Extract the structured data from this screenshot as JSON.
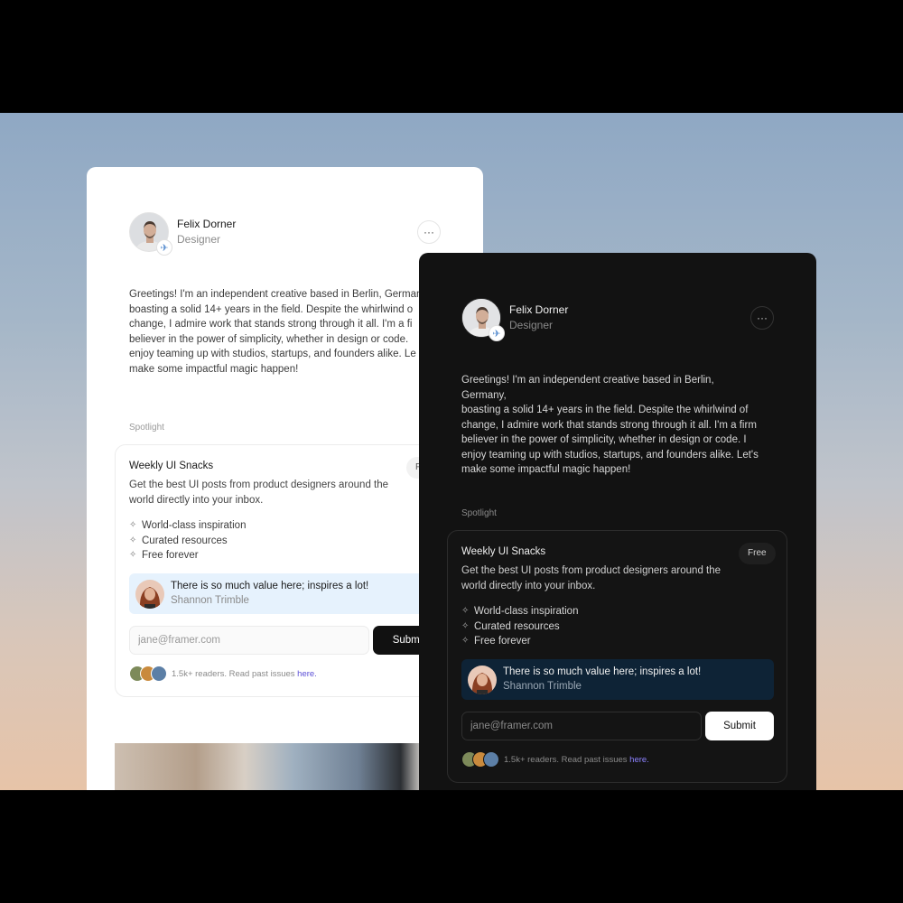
{
  "profile": {
    "name": "Felix Dorner",
    "role": "Designer",
    "more_label": "···",
    "badge_icon": "airplane-icon"
  },
  "bio_light": "Greetings! I'm an independent creative based in Berlin, German\nboasting a solid 14+ years in the field. Despite the whirlwind o\nchange, I admire work that stands strong through it all. I'm a fi\nbeliever in the power of simplicity, whether in design or code.\nenjoy teaming up with studios, startups, and founders alike. Le\nmake some impactful magic happen!",
  "bio_dark": "Greetings! I'm an independent creative based in Berlin, Germany,\nboasting a solid 14+ years in the field. Despite the whirlwind of\nchange, I admire work that stands strong through it all. I'm a firm\nbeliever in the power of simplicity, whether in design or code. I\nenjoy teaming up with studios, startups, and founders alike. Let's\nmake some impactful magic happen!",
  "spotlight": {
    "section_label": "Spotlight",
    "title": "Weekly UI Snacks",
    "badge_dark": "Free",
    "badge_light": "F",
    "description": "Get the best UI posts from product designers around the world directly into your inbox.",
    "features": [
      "World-class inspiration",
      "Curated resources",
      "Free forever"
    ],
    "quote": {
      "text": "There is so much value here; inspires a lot!",
      "author": "Shannon Trimble"
    },
    "email_placeholder": "jane@framer.com",
    "submit_label_dark": "Submit",
    "submit_label_light": "Submi",
    "readers_text": "1.5k+ readers. Read past issues ",
    "readers_link": "here."
  },
  "colors": {
    "link_light": "#5b4fd6",
    "link_dark": "#8c82ff",
    "quote_bg_light": "#e6f2fd",
    "quote_bg_dark": "#0e2336"
  }
}
